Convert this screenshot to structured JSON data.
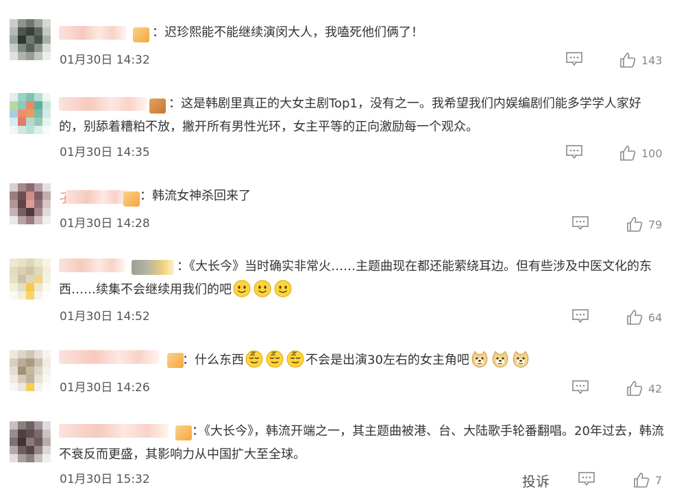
{
  "comments": [
    {
      "text": "：迟珍熙能不能继续演闵大人，我嗑死他们俩了！",
      "time": "01月30日 14:32",
      "likes": "143"
    },
    {
      "text": "：这是韩剧里真正的大女主剧Top1，没有之一。我希望我们内娱编剧们能多学学人家好的，别舔着糟粕不放，撇开所有男性光环，女主平等的正向激励每一个观众。",
      "time": "01月30日 14:35",
      "likes": "100"
    },
    {
      "name_fragment": "孑",
      "text": "：韩流女神杀回来了",
      "time": "01月30日 14:28",
      "likes": "79"
    },
    {
      "text": "：《大长今》当时确实非常火……主题曲现在都还能萦绕耳边。但有些涉及中医文化的东西……续集不会继续用我们的吧",
      "time": "01月30日 14:52",
      "likes": "64"
    },
    {
      "text_a": "：什么东西",
      "text_b": "不会是出演30左右的女主角吧",
      "time": "01月30日 14:26",
      "likes": "42"
    },
    {
      "text": "：《大长今》，韩流开端之一，其主题曲被港、台、大陆歌手轮番翻唱。20年过去，韩流不衰反而更盛，其影响力从中国扩大至全球。",
      "time": "01月30日 15:32",
      "likes": "7",
      "report": "投诉"
    }
  ]
}
